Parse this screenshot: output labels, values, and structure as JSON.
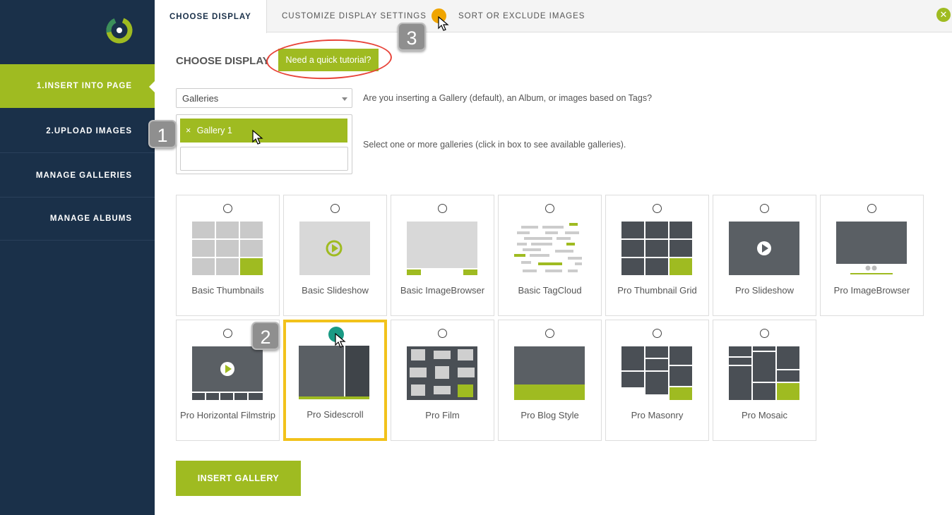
{
  "sidebar": {
    "items": [
      {
        "label": "1.INSERT INTO PAGE"
      },
      {
        "label": "2.UPLOAD IMAGES"
      },
      {
        "label": "MANAGE GALLERIES"
      },
      {
        "label": "MANAGE ALBUMS"
      }
    ],
    "active_index": 0
  },
  "tabs": [
    {
      "label": "CHOOSE DISPLAY"
    },
    {
      "label": "CUSTOMIZE DISPLAY SETTINGS"
    },
    {
      "label": "SORT OR EXCLUDE IMAGES"
    }
  ],
  "close_icon": "close-icon",
  "main": {
    "heading": "CHOOSE DISPLAY",
    "tutorial_label": "Need a quick tutorial?",
    "select_value": "Galleries",
    "select_help": "Are you inserting a Gallery (default), an Album, or images based on Tags?",
    "chip_label": "Gallery 1",
    "chip_remove": "×",
    "galleries_help": "Select one or more galleries (click in box to see available galleries).",
    "insert_label": "INSERT GALLERY"
  },
  "callouts": [
    "1",
    "2",
    "3"
  ],
  "displays": [
    {
      "label": "Basic Thumbnails",
      "icon": "basic-thumbnails-icon"
    },
    {
      "label": "Basic Slideshow",
      "icon": "basic-slideshow-icon"
    },
    {
      "label": "Basic ImageBrowser",
      "icon": "basic-imagebrowser-icon"
    },
    {
      "label": "Basic TagCloud",
      "icon": "basic-tagcloud-icon"
    },
    {
      "label": "Pro Thumbnail Grid",
      "icon": "pro-thumbnail-grid-icon"
    },
    {
      "label": "Pro Slideshow",
      "icon": "pro-slideshow-icon"
    },
    {
      "label": "Pro ImageBrowser",
      "icon": "pro-imagebrowser-icon"
    },
    {
      "label": "Pro Horizontal Filmstrip",
      "icon": "pro-horizontal-filmstrip-icon"
    },
    {
      "label": "Pro Sidescroll",
      "icon": "pro-sidescroll-icon",
      "selected": true
    },
    {
      "label": "Pro Film",
      "icon": "pro-film-icon"
    },
    {
      "label": "Pro Blog Style",
      "icon": "pro-blog-style-icon"
    },
    {
      "label": "Pro Masonry",
      "icon": "pro-masonry-icon"
    },
    {
      "label": "Pro Mosaic",
      "icon": "pro-mosaic-icon"
    }
  ],
  "colors": {
    "accent": "#9fbb21",
    "sidebar": "#1a3049",
    "highlight": "#f2c21b",
    "selected_radio": "#1a9a84",
    "annotation": "#e8443a"
  }
}
